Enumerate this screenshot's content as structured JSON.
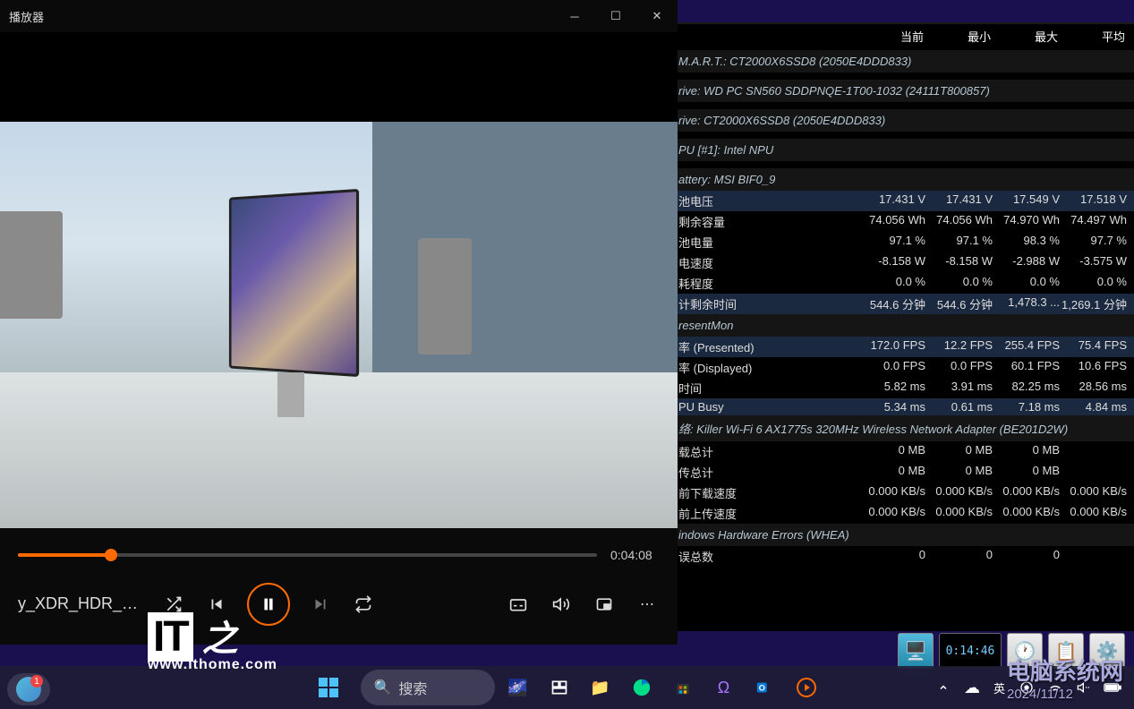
{
  "player": {
    "title": "播放器",
    "filename": "y_XDR_HDR_14...",
    "current_time": "0:04:08"
  },
  "hwinfo": {
    "columns": {
      "current": "当前",
      "min": "最小",
      "max": "最大",
      "avg": "平均"
    },
    "sections": [
      {
        "label": "M.A.R.T.: CT2000X6SSD8 (2050E4DDD833)",
        "rows": []
      },
      {
        "label": "rive: WD PC SN560 SDDPNQE-1T00-1032 (24111T800857)",
        "rows": []
      },
      {
        "label": "rive: CT2000X6SSD8 (2050E4DDD833)",
        "rows": []
      },
      {
        "label": "PU [#1]: Intel NPU",
        "rows": []
      },
      {
        "label": "attery: MSI BIF0_9",
        "rows": [
          {
            "name": "池电压",
            "cur": "17.431 V",
            "min": "17.431 V",
            "max": "17.549 V",
            "avg": "17.518 V",
            "hl": true
          },
          {
            "name": "剩余容量",
            "cur": "74.056 Wh",
            "min": "74.056 Wh",
            "max": "74.970 Wh",
            "avg": "74.497 Wh"
          },
          {
            "name": "池电量",
            "cur": "97.1 %",
            "min": "97.1 %",
            "max": "98.3 %",
            "avg": "97.7 %"
          },
          {
            "name": "电速度",
            "cur": "-8.158 W",
            "min": "-8.158 W",
            "max": "-2.988 W",
            "avg": "-3.575 W"
          },
          {
            "name": "耗程度",
            "cur": "0.0 %",
            "min": "0.0 %",
            "max": "0.0 %",
            "avg": "0.0 %"
          },
          {
            "name": "计剩余时间",
            "cur": "544.6 分钟",
            "min": "544.6 分钟",
            "max": "1,478.3 ...",
            "avg": "1,269.1 分钟",
            "hl": true
          }
        ]
      },
      {
        "label": "resentMon",
        "rows": [
          {
            "name": "率 (Presented)",
            "cur": "172.0 FPS",
            "min": "12.2 FPS",
            "max": "255.4 FPS",
            "avg": "75.4 FPS",
            "hl": true
          },
          {
            "name": "率 (Displayed)",
            "cur": "0.0 FPS",
            "min": "0.0 FPS",
            "max": "60.1 FPS",
            "avg": "10.6 FPS"
          },
          {
            "name": "时间",
            "cur": "5.82 ms",
            "min": "3.91 ms",
            "max": "82.25 ms",
            "avg": "28.56 ms"
          },
          {
            "name": "PU Busy",
            "cur": "5.34 ms",
            "min": "0.61 ms",
            "max": "7.18 ms",
            "avg": "4.84 ms",
            "hl": true
          }
        ]
      },
      {
        "label": "络: Killer Wi-Fi 6 AX1775s 320MHz Wireless Network Adapter (BE201D2W)",
        "rows": [
          {
            "name": "载总计",
            "cur": "0 MB",
            "min": "0 MB",
            "max": "0 MB",
            "avg": ""
          },
          {
            "name": "传总计",
            "cur": "0 MB",
            "min": "0 MB",
            "max": "0 MB",
            "avg": ""
          },
          {
            "name": "前下载速度",
            "cur": "0.000 KB/s",
            "min": "0.000 KB/s",
            "max": "0.000 KB/s",
            "avg": "0.000 KB/s"
          },
          {
            "name": "前上传速度",
            "cur": "0.000 KB/s",
            "min": "0.000 KB/s",
            "max": "0.000 KB/s",
            "avg": "0.000 KB/s"
          }
        ]
      },
      {
        "label": "indows Hardware Errors (WHEA)",
        "rows": [
          {
            "name": "误总数",
            "cur": "0",
            "min": "0",
            "max": "0",
            "avg": ""
          }
        ]
      }
    ]
  },
  "tray_timer": "0:14:46",
  "taskbar": {
    "search_placeholder": "搜索",
    "ime": "英",
    "widget_badge": "1"
  },
  "watermarks": {
    "ithome_logo": "IT",
    "ithome_url": "www.ithome.com",
    "dnxtw": "电脑系统网",
    "dnxtw_date": "2024/11/12"
  }
}
